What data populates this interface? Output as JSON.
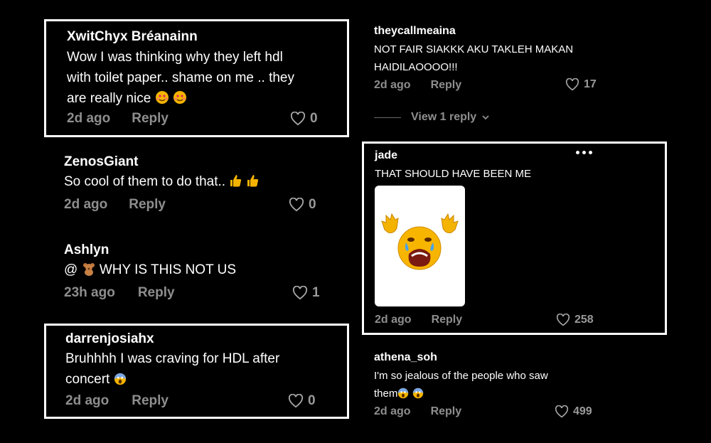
{
  "left_comments": [
    {
      "username": "XwitChyx Bréanainn",
      "lines": [
        "Wow I was thinking why they left hdl",
        "with toilet paper.. shame on me .. they",
        "are really nice"
      ],
      "time": "2d ago",
      "reply": "Reply",
      "likes": "0"
    },
    {
      "username": "ZenosGiant",
      "lines": [
        "So cool of them to do that.."
      ],
      "time": "2d ago",
      "reply": "Reply",
      "likes": "0"
    },
    {
      "username": "Ashlyn",
      "lines": [
        "@",
        "WHY IS THIS NOT US"
      ],
      "time": "23h ago",
      "reply": "Reply",
      "likes": "1"
    },
    {
      "username": "darrenjosiahx",
      "lines": [
        "Bruhhhh I was craving for HDL after",
        "concert"
      ],
      "time": "2d ago",
      "reply": "Reply",
      "likes": "0"
    }
  ],
  "right_comments": [
    {
      "username": "theycallmeaina",
      "lines": [
        "NOT FAIR SIAKKK AKU TAKLEH MAKAN",
        "HAIDILAOOOO!!!"
      ],
      "time": "2d ago",
      "reply": "Reply",
      "likes": "17",
      "view_replies": "View 1 reply"
    },
    {
      "username": "jade",
      "lines": [
        "THAT SHOULD HAVE BEEN ME"
      ],
      "time": "2d ago",
      "reply": "Reply",
      "likes": "258",
      "sticker": "crying-face-sticker"
    },
    {
      "username": "athena_soh",
      "lines": [
        "I'm so jealous of the people who saw",
        "them"
      ],
      "time": "2d ago",
      "reply": "Reply",
      "likes": "499"
    }
  ],
  "colors": {
    "background": "#000000",
    "text": "#ffffff",
    "muted": "#8e8e8e",
    "highlight_border": "#ffffff"
  },
  "icons": {
    "like": "heart-outline-icon",
    "more": "more-options-icon",
    "chevron": "chevron-down-icon"
  }
}
